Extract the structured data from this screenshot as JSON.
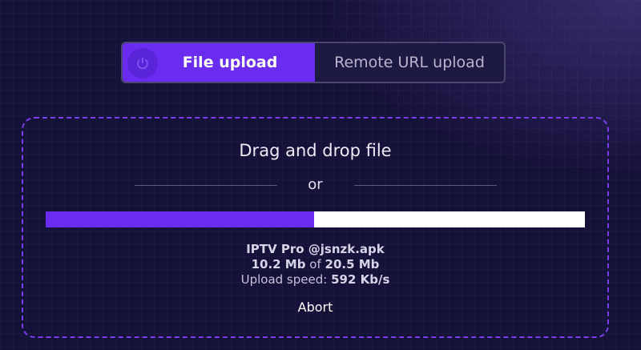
{
  "tabs": {
    "file_upload_label": "File upload",
    "remote_url_label": "Remote URL upload",
    "active": "file_upload"
  },
  "icons": {
    "power": "power-icon"
  },
  "dropzone": {
    "title": "Drag and drop file",
    "or_label": "or"
  },
  "upload": {
    "file_name": "IPTV Pro @jsnzk.apk",
    "uploaded": "10.2 Mb",
    "of_label": "of",
    "total": "20.5 Mb",
    "speed_label": "Upload speed:",
    "speed": "592 Kb/s",
    "progress_fraction": 0.4975,
    "abort_label": "Abort"
  },
  "colors": {
    "background": "#15123a",
    "accent": "#6a2cf0",
    "progress_track": "#ffffff"
  }
}
